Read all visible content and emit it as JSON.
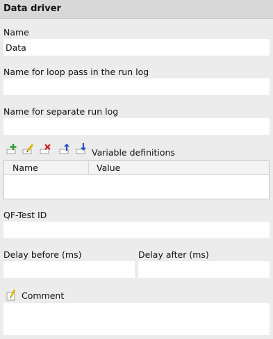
{
  "header": {
    "title": "Data driver"
  },
  "name": {
    "label": "Name",
    "value": "Data"
  },
  "loop_pass_name": {
    "label": "Name for loop pass in the run log",
    "value": ""
  },
  "separate_run_log": {
    "label": "Name for separate run log",
    "value": ""
  },
  "variables": {
    "label": "Variable definitions",
    "toolbar": [
      {
        "name": "add-icon",
        "color": "#2aa02a"
      },
      {
        "name": "edit-icon",
        "color": "#e0b000"
      },
      {
        "name": "delete-icon",
        "color": "#cc1a1a"
      },
      {
        "name": "move-up-icon",
        "color": "#2050c0"
      },
      {
        "name": "move-down-icon",
        "color": "#2050c0"
      }
    ],
    "columns": [
      "Name",
      "Value"
    ],
    "rows": []
  },
  "qftest_id": {
    "label": "QF-Test ID",
    "value": ""
  },
  "delay_before": {
    "label": "Delay before (ms)",
    "value": ""
  },
  "delay_after": {
    "label": "Delay after (ms)",
    "value": ""
  },
  "comment": {
    "label": "Comment",
    "value": ""
  }
}
